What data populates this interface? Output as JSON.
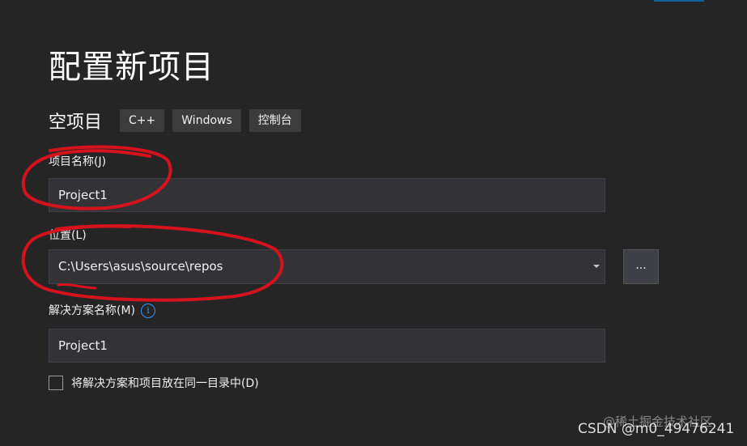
{
  "page": {
    "title": "配置新项目",
    "template_name": "空项目",
    "tags": [
      "C++",
      "Windows",
      "控制台"
    ]
  },
  "form": {
    "project_name_label": "项目名称(J)",
    "project_name_value": "Project1",
    "location_label": "位置(L)",
    "location_value": "C:\\Users\\asus\\source\\repos",
    "browse_label": "...",
    "solution_name_label": "解决方案名称(M)",
    "solution_name_value": "Project1",
    "same_dir_label": "将解决方案和项目放在同一目录中(D)",
    "same_dir_checked": false
  },
  "icons": {
    "info": "info-icon",
    "dropdown": "chevron-down-icon"
  },
  "watermark": {
    "juejin": "@稀土掘金技术社区",
    "csdn": "CSDN @m0_49476241"
  },
  "colors": {
    "background": "#252526",
    "input_bg": "#333337",
    "tag_bg": "#3c3c3c",
    "accent": "#0e639c",
    "annotation": "#d6121c"
  }
}
